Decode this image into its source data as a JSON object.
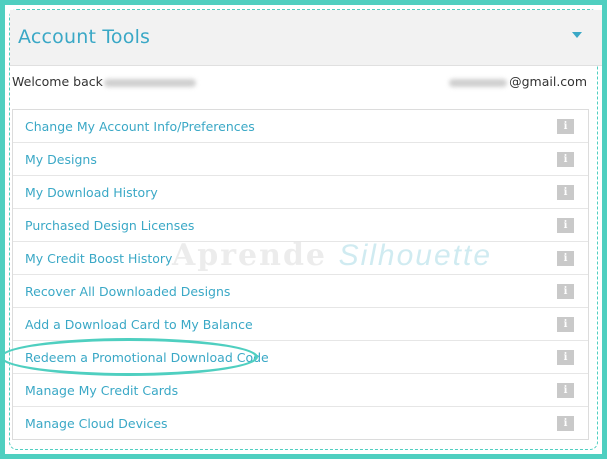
{
  "panel": {
    "title": "Account Tools"
  },
  "welcome": {
    "label": "Welcome back",
    "email_suffix": "@gmail.com"
  },
  "menu": {
    "items": [
      {
        "label": "Change My Account Info/Preferences"
      },
      {
        "label": "My Designs"
      },
      {
        "label": "My Download History"
      },
      {
        "label": "Purchased Design Licenses"
      },
      {
        "label": "My Credit Boost History"
      },
      {
        "label": "Recover All Downloaded Designs"
      },
      {
        "label": "Add a Download Card to My Balance"
      },
      {
        "label": "Redeem a Promotional Download Code"
      },
      {
        "label": "Manage My Credit Cards"
      },
      {
        "label": "Manage Cloud Devices"
      }
    ],
    "info_glyph": "i"
  },
  "watermark": {
    "part1": "Aprende",
    "part2": "Silhouette"
  },
  "colors": {
    "accent": "#4fcfc0",
    "link": "#3aa8c6",
    "badge": "#c9c9c9"
  }
}
